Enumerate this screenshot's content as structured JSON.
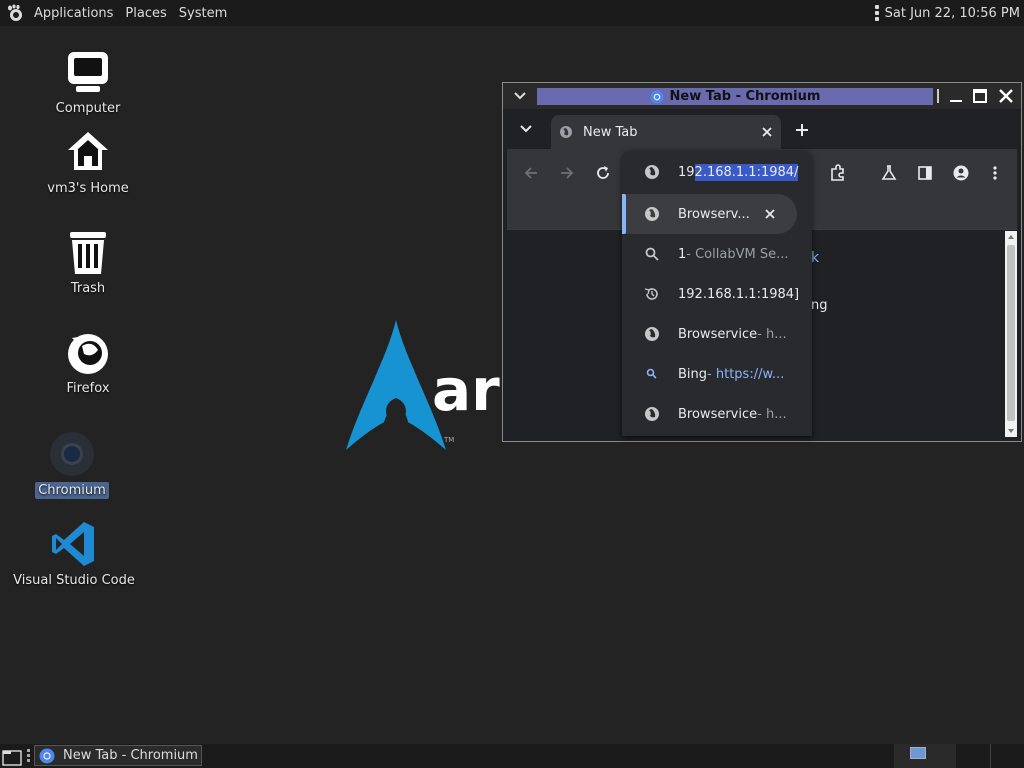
{
  "top_panel": {
    "menus": [
      "Applications",
      "Places",
      "System"
    ],
    "clock": "Sat Jun 22, 10:56 PM"
  },
  "desktop": {
    "icons": [
      {
        "label": "Computer",
        "icon": "computer-icon"
      },
      {
        "label": "vm3's Home",
        "icon": "home-icon"
      },
      {
        "label": "Trash",
        "icon": "trash-icon"
      },
      {
        "label": "Firefox",
        "icon": "firefox-icon"
      },
      {
        "label": "Chromium",
        "icon": "chromium-icon",
        "selected": true
      },
      {
        "label": "Visual Studio Code",
        "icon": "vscode-icon"
      }
    ],
    "wallpaper_text": "arc"
  },
  "window": {
    "title": "New Tab - Chromium",
    "tab_label": "New Tab",
    "omnibox_value": "192.168.1.1:1984/",
    "omnibox_prefix": "19",
    "omnibox_rest": "2.168.1.1:1984/",
    "content_fragments": [
      "k",
      "ng"
    ],
    "suggestions": [
      {
        "icon": "globe-icon",
        "text": "Browserv...",
        "sub": "",
        "selected": true
      },
      {
        "icon": "search-icon",
        "text": "1",
        "sub": " - CollabVM Se..."
      },
      {
        "icon": "history-icon",
        "text": "192.168.1.1:1984]",
        "sub": ""
      },
      {
        "icon": "globe-icon",
        "text": "Browservice",
        "sub": " - h..."
      },
      {
        "icon": "search-icon",
        "text": "Bing",
        "sub": " - https://w..."
      },
      {
        "icon": "globe-icon",
        "text": "Browservice",
        "sub": " - h..."
      }
    ]
  },
  "taskbar": {
    "task_label": "New Tab - Chromium"
  },
  "colors": {
    "accent": "#8ab4f8",
    "title_active": "#6a6ab0",
    "desktop_bg": "#232323"
  }
}
